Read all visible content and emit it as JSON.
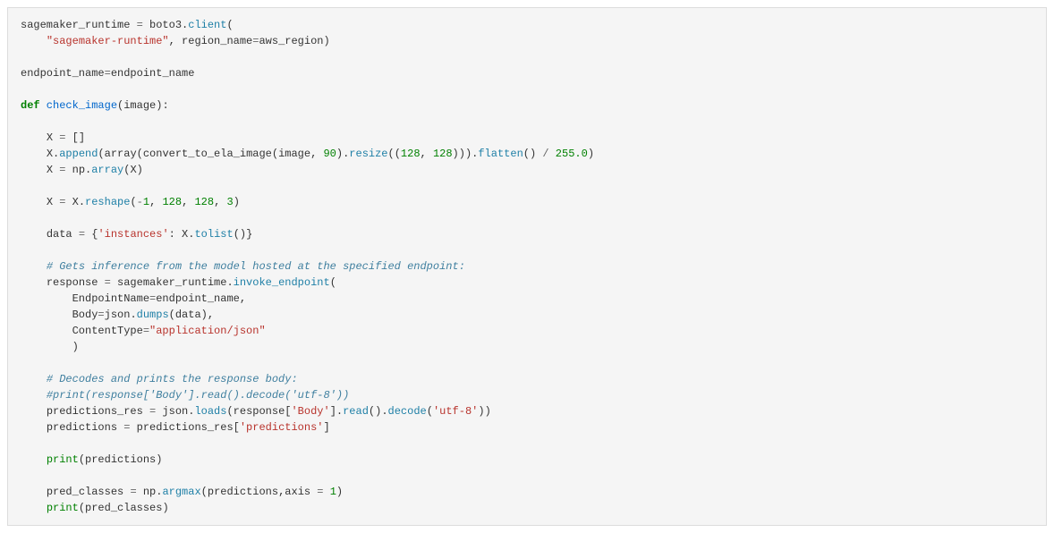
{
  "code": {
    "line1_name1": "sagemaker_runtime ",
    "line1_op1": "=",
    "line1_name2": " boto3",
    "line1_punct1": ".",
    "line1_attr1": "client",
    "line1_punct2": "(",
    "line2_indent": "    ",
    "line2_str1": "\"sagemaker-runtime\"",
    "line2_punct1": ", region_name",
    "line2_op1": "=",
    "line2_name1": "aws_region)",
    "line4_name1": "endpoint_name",
    "line4_op1": "=",
    "line4_name2": "endpoint_name",
    "line6_kw1": "def",
    "line6_fn1": " check_image",
    "line6_punct1": "(image):",
    "line8_indent": "    ",
    "line8_name1": "X ",
    "line8_op1": "=",
    "line8_name2": " []",
    "line9_indent": "    ",
    "line9_name1": "X",
    "line9_punct1": ".",
    "line9_attr1": "append",
    "line9_name2": "(array(convert_to_ela_image(image, ",
    "line9_num1": "90",
    "line9_punct2": ")",
    "line9_punct3": ".",
    "line9_attr2": "resize",
    "line9_punct4": "((",
    "line9_num2": "128",
    "line9_punct5": ", ",
    "line9_num3": "128",
    "line9_punct6": ")))",
    "line9_punct7": ".",
    "line9_attr3": "flatten",
    "line9_punct8": "() ",
    "line9_op2": "/",
    "line9_punct9": " ",
    "line9_num4": "255.0",
    "line9_punct10": ")",
    "line10_indent": "    ",
    "line10_name1": "X ",
    "line10_op1": "=",
    "line10_name2": " np",
    "line10_punct1": ".",
    "line10_attr1": "array",
    "line10_punct2": "(X)",
    "line12_indent": "    ",
    "line12_name1": "X ",
    "line12_op1": "=",
    "line12_name2": " X",
    "line12_punct1": ".",
    "line12_attr1": "reshape",
    "line12_punct2": "(",
    "line12_op2": "-",
    "line12_num1": "1",
    "line12_punct3": ", ",
    "line12_num2": "128",
    "line12_punct4": ", ",
    "line12_num3": "128",
    "line12_punct5": ", ",
    "line12_num4": "3",
    "line12_punct6": ")",
    "line14_indent": "    ",
    "line14_name1": "data ",
    "line14_op1": "=",
    "line14_name2": " {",
    "line14_str1": "'instances'",
    "line14_punct1": ": X",
    "line14_punct2": ".",
    "line14_attr1": "tolist",
    "line14_punct3": "()}",
    "line16_indent": "    ",
    "line16_cmt1": "# Gets inference from the model hosted at the specified endpoint:",
    "line17_indent": "    ",
    "line17_name1": "response ",
    "line17_op1": "=",
    "line17_name2": " sagemaker_runtime",
    "line17_punct1": ".",
    "line17_attr1": "invoke_endpoint",
    "line17_punct2": "(",
    "line18_indent": "        ",
    "line18_name1": "EndpointName",
    "line18_op1": "=",
    "line18_name2": "endpoint_name,",
    "line19_indent": "        ",
    "line19_name1": "Body",
    "line19_op1": "=",
    "line19_name2": "json",
    "line19_punct1": ".",
    "line19_attr1": "dumps",
    "line19_punct2": "(data),",
    "line20_indent": "        ",
    "line20_name1": "ContentType",
    "line20_op1": "=",
    "line20_str1": "\"application/json\"",
    "line21_indent": "        ",
    "line21_punct1": ")",
    "line23_indent": "    ",
    "line23_cmt1": "# Decodes and prints the response body:",
    "line24_indent": "    ",
    "line24_cmt1": "#print(response['Body'].read().decode('utf-8'))",
    "line25_indent": "    ",
    "line25_name1": "predictions_res ",
    "line25_op1": "=",
    "line25_name2": " json",
    "line25_punct1": ".",
    "line25_attr1": "loads",
    "line25_punct2": "(response[",
    "line25_str1": "'Body'",
    "line25_punct3": "]",
    "line25_punct4": ".",
    "line25_attr2": "read",
    "line25_punct5": "()",
    "line25_punct6": ".",
    "line25_attr3": "decode",
    "line25_punct7": "(",
    "line25_str2": "'utf-8'",
    "line25_punct8": "))",
    "line26_indent": "    ",
    "line26_name1": "predictions ",
    "line26_op1": "=",
    "line26_name2": " predictions_res[",
    "line26_str1": "'predictions'",
    "line26_punct1": "]",
    "line28_indent": "    ",
    "line28_builtin1": "print",
    "line28_punct1": "(predictions)",
    "line30_indent": "    ",
    "line30_name1": "pred_classes ",
    "line30_op1": "=",
    "line30_name2": " np",
    "line30_punct1": ".",
    "line30_attr1": "argmax",
    "line30_punct2": "(predictions,axis ",
    "line30_op2": "=",
    "line30_punct3": " ",
    "line30_num1": "1",
    "line30_punct4": ")",
    "line31_indent": "    ",
    "line31_builtin1": "print",
    "line31_punct1": "(pred_classes)"
  }
}
